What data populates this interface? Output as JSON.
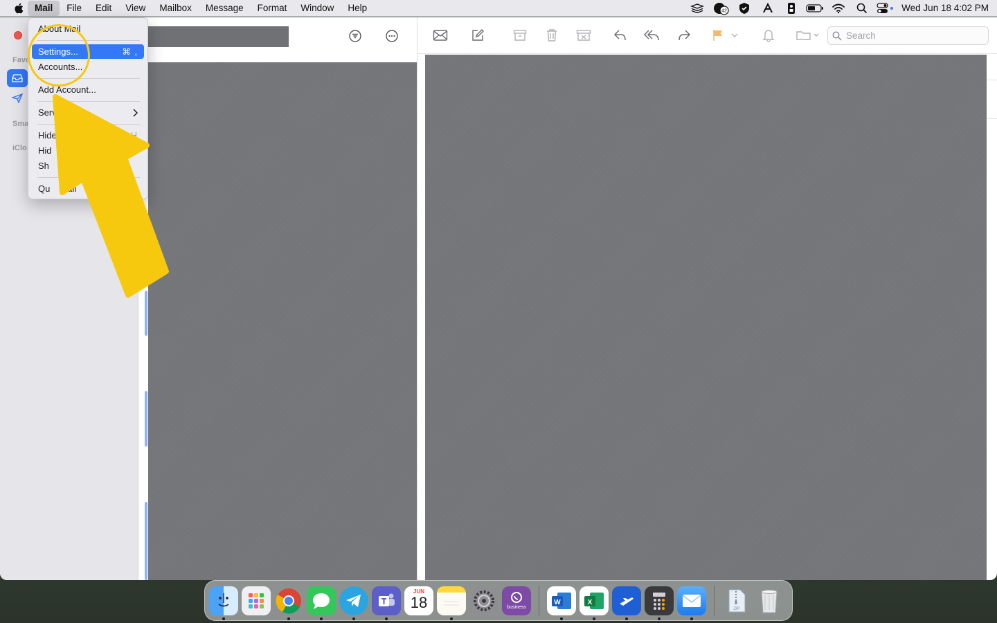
{
  "menubar": {
    "items": [
      "Mail",
      "File",
      "Edit",
      "View",
      "Mailbox",
      "Message",
      "Format",
      "Window",
      "Help"
    ],
    "clock": "Wed Jun 18  4:02 PM",
    "status_icons": [
      "layers-icon",
      "notification-badge-icon",
      "shield-icon",
      "creative-cloud-icon",
      "tag-icon",
      "battery-icon",
      "wifi-icon",
      "search-icon",
      "control-center-icon"
    ],
    "badge": "42"
  },
  "sidebar": {
    "sections": [
      "Favo",
      "Sma",
      "iClo"
    ]
  },
  "app_menu": {
    "items": [
      {
        "label": "About Mail",
        "shortcut": ""
      },
      {
        "label": "Settings...",
        "shortcut": "⌘ ,"
      },
      {
        "label": "Accounts...",
        "shortcut": ""
      },
      {
        "label": "Add Account...",
        "shortcut": ""
      },
      {
        "label": "Servic",
        "shortcut": ""
      },
      {
        "label": "Hide",
        "shortcut": "H"
      },
      {
        "label": "Hid",
        "shortcut": ""
      },
      {
        "label": "Sh",
        "shortcut": ""
      },
      {
        "label": "Qu",
        "shortcut": ""
      },
      {
        "label": "Mail",
        "shortcut": "Q"
      }
    ]
  },
  "toolbar": {
    "search_placeholder": "Search"
  },
  "dock": {
    "apps": [
      "Finder",
      "Launchpad",
      "Chrome",
      "Messages",
      "Telegram",
      "Teams",
      "Calendar",
      "Notes",
      "System Settings",
      "Viber",
      "Word",
      "Excel",
      "Dispatch",
      "Calculator",
      "Mail",
      "Archive",
      "Trash"
    ],
    "calendar_month": "JUN",
    "calendar_day": "18",
    "viber_caption": "business",
    "archive_caption": "ZIP"
  },
  "colors": {
    "accent": "#3478f6",
    "annotation": "#f6c90e",
    "redaction": "#76777b"
  }
}
